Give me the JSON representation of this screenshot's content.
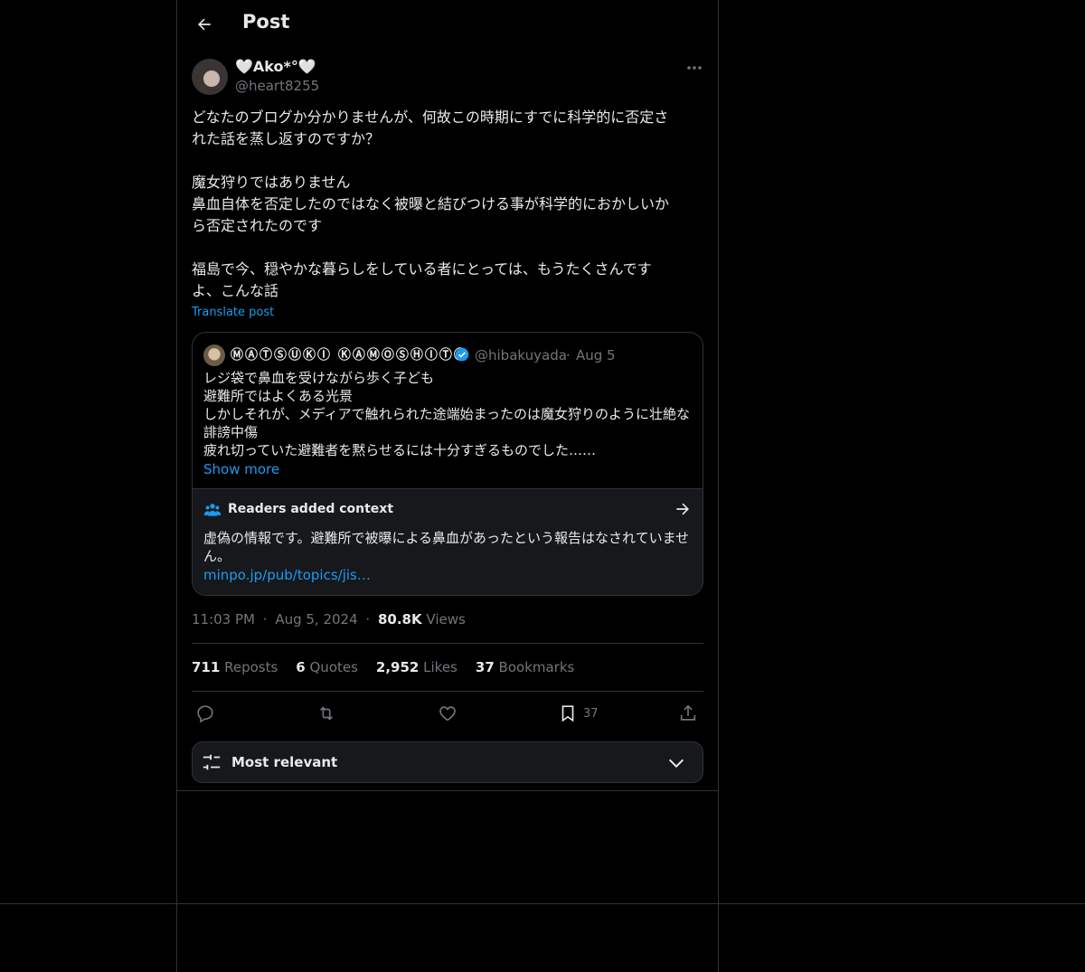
{
  "header": {
    "title": "Post"
  },
  "post": {
    "display_name": "🤍Ako*°🤍",
    "handle": "@heart8255",
    "text": "どなたのブログか分かりませんが、何故この時期にすでに科学的に否定さ\nれた話を蒸し返すのですか？\n\n魔女狩りではありません\n鼻血自体を否定したのではなく被曝と結びつける事が科学的におかしいか\nら否定されたのです\n\n福島で今、穏やかな暮らしをしている者にとっては、もうたくさんです\nよ、こんな話",
    "translate_label": "Translate post"
  },
  "quote": {
    "display_name": "ⓂⒶⓉⓈⓊⓀⒾ ⓀⒶⓂⓄⓈⒽⒾⓉⒶ",
    "handle": "@hibakuyada",
    "separator": "·",
    "date": "Aug 5",
    "text": "レジ袋で鼻血を受けながら歩く子ども\n避難所ではよくある光景\nしかしそれが、メディアで触れられた途端始まったのは魔女狩りのように壮絶な\n誹謗中傷\n疲れ切っていた避難者を黙らせるには十分すぎるものでした……",
    "show_more": "Show more"
  },
  "context": {
    "title": "Readers added context",
    "text": "虚偽の情報です。避難所で被曝による鼻血があったという報告はなされていませ\nん。",
    "link": "minpo.jp/pub/topics/jis…"
  },
  "meta": {
    "time": "11:03 PM",
    "sep": "·",
    "date": "Aug 5, 2024",
    "views": "80.8K",
    "views_label": "Views"
  },
  "stats": {
    "reposts": "711",
    "reposts_label": "Reposts",
    "quotes": "6",
    "quotes_label": "Quotes",
    "likes": "2,952",
    "likes_label": "Likes",
    "bookmarks": "37",
    "bookmarks_label": "Bookmarks"
  },
  "actions": {
    "bookmark_count": "37",
    "icons": [
      "reply-icon",
      "repost-icon",
      "like-icon",
      "bookmark-icon",
      "share-icon"
    ]
  },
  "sort": {
    "label": "Most relevant"
  },
  "colors": {
    "background": "#000000",
    "border": "#2f3336",
    "accent": "#1d9bf0",
    "muted": "#71767b",
    "text": "#e7e9ea"
  }
}
